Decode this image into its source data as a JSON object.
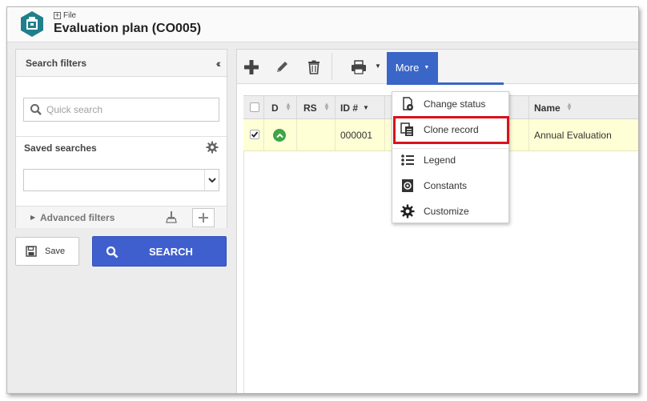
{
  "header": {
    "breadcrumb": "File",
    "title": "Evaluation plan (CO005)"
  },
  "filters": {
    "title": "Search filters",
    "quick_search_placeholder": "Quick search",
    "saved_searches_label": "Saved searches",
    "saved_search_value": "",
    "advanced_filters_label": "Advanced filters",
    "save_label": "Save",
    "search_label": "SEARCH"
  },
  "toolbar": {
    "more_label": "More"
  },
  "grid": {
    "columns": [
      "D",
      "RS",
      "ID #",
      "Name"
    ],
    "rows": [
      {
        "checked": true,
        "status": "approved",
        "rs": "",
        "id": "000001",
        "name": "Annual Evaluation"
      }
    ]
  },
  "more_menu": {
    "items": [
      "Change status",
      "Clone record",
      "Legend",
      "Constants",
      "Customize"
    ],
    "highlighted": "Clone record"
  },
  "colors": {
    "accent_blue": "#3a66c8",
    "search_button": "#3f5fcf",
    "row_selected": "#ffffd6",
    "status_green": "#3fa546",
    "highlight_red": "#d9121a",
    "app_icon": "#1f7f8c"
  }
}
